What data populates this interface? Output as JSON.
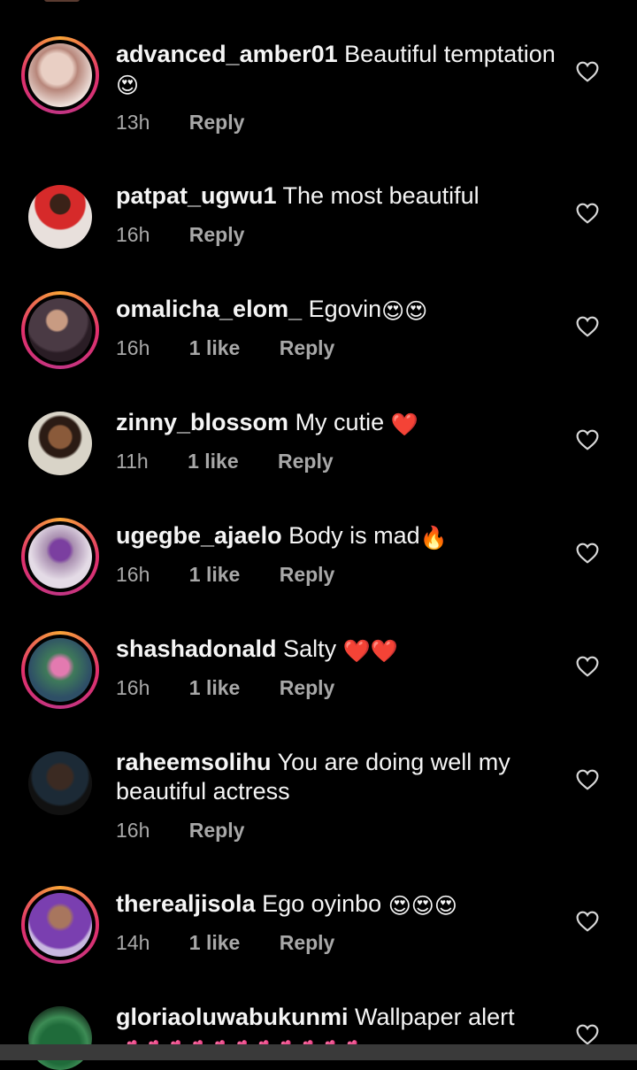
{
  "comments": [
    {
      "username": "advanced_amber01",
      "text": "Beautiful temptation",
      "emoji": "😍",
      "time": "13h",
      "likes": "",
      "reply": "Reply"
    },
    {
      "username": "patpat_ugwu1",
      "text": "The most beautiful",
      "emoji": "",
      "time": "16h",
      "likes": "",
      "reply": "Reply"
    },
    {
      "username": "omalicha_elom_",
      "text": "Egovin",
      "emoji": "😍😍",
      "time": "16h",
      "likes": "1 like",
      "reply": "Reply"
    },
    {
      "username": "zinny_blossom",
      "text": "My cutie",
      "emoji": "❤️",
      "time": "11h",
      "likes": "1 like",
      "reply": "Reply"
    },
    {
      "username": "ugegbe_ajaelo",
      "text": "Body is mad",
      "emoji": "🔥",
      "time": "16h",
      "likes": "1 like",
      "reply": "Reply"
    },
    {
      "username": "shashadonald",
      "text": "Salty",
      "emoji": "❤️❤️",
      "time": "16h",
      "likes": "1 like",
      "reply": "Reply"
    },
    {
      "username": "raheemsolihu",
      "text": "You are doing well my beautiful actress",
      "emoji": "",
      "time": "16h",
      "likes": "",
      "reply": "Reply"
    },
    {
      "username": "therealjisola",
      "text": "Ego oyinbo",
      "emoji": "😍😍😍",
      "time": "14h",
      "likes": "1 like",
      "reply": "Reply"
    },
    {
      "username": "gloriaoluwabukunmi",
      "text": "Wallpaper alert",
      "emoji": "💕💕💕💕💕💕💕💕💕💕💕",
      "time": "",
      "likes": "",
      "reply": ""
    }
  ],
  "icons": {
    "like": "heart-outline-icon"
  },
  "colors": {
    "background": "#000000",
    "text": "#f5f5f5",
    "muted": "#a8a8a8",
    "story_ring": "#e1306c"
  }
}
